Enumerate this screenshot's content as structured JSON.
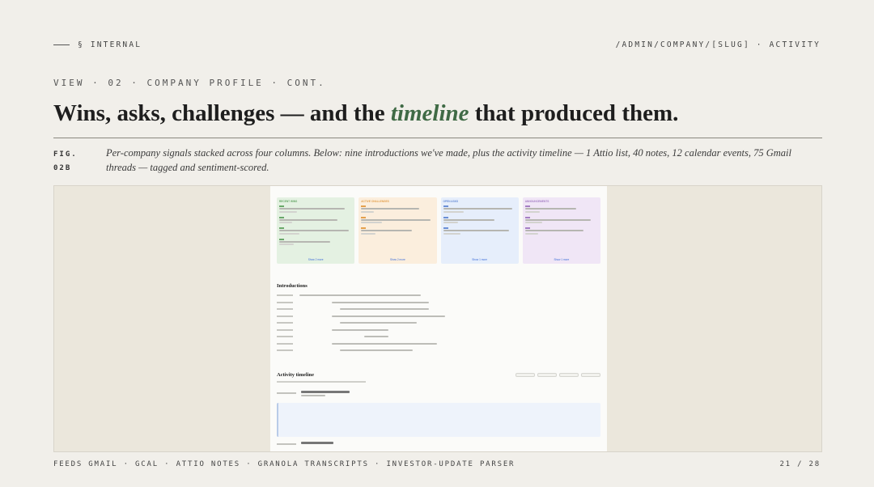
{
  "header": {
    "section_label": "§ INTERNAL",
    "route": "/ADMIN/COMPANY/[SLUG] · ACTIVITY"
  },
  "eyebrow": "VIEW · 02 · COMPANY PROFILE · CONT.",
  "headline": {
    "before": "Wins, asks, challenges — and the ",
    "emphasis": "timeline",
    "after": " that produced them."
  },
  "figure": {
    "label_line1": "FIG.",
    "label_line2": "02B",
    "caption": "Per-company signals stacked across four columns. Below: nine introductions we've made, plus the activity timeline — 1 Attio list, 40 notes, 12 calendar events, 75 Gmail threads — tagged and sentiment-scored."
  },
  "screenshot": {
    "columns": [
      {
        "title": "RECENT WINS",
        "bg": "#e4f1e2",
        "accent": "#6aa86a",
        "items": 4,
        "show_more": "Show 2 more"
      },
      {
        "title": "ACTIVE CHALLENGES",
        "bg": "#fbeedd",
        "accent": "#e4a04d",
        "items": 3,
        "show_more": "Show 2 more"
      },
      {
        "title": "OPEN ASKS",
        "bg": "#e6eefb",
        "accent": "#6b8fd6",
        "items": 3,
        "show_more": "Show 1 more"
      },
      {
        "title": "ANNOUNCEMENTS",
        "bg": "#f0e6f6",
        "accent": "#a57fc4",
        "items": 3,
        "show_more": "Show 1 more"
      }
    ],
    "introductions_title": "Introductions",
    "timeline_title": "Activity timeline"
  },
  "footer": {
    "feeds": "FEEDS GMAIL · GCAL · ATTIO NOTES · GRANOLA TRANSCRIPTS · INVESTOR-UPDATE PARSER",
    "page": "21 / 28"
  }
}
